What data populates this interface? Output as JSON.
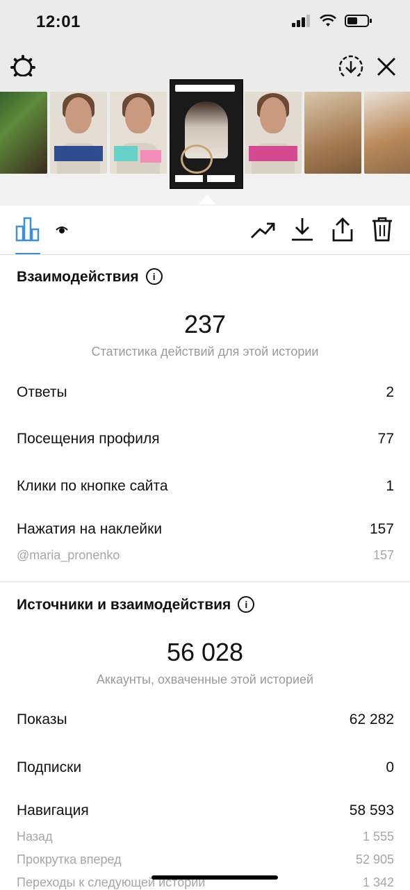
{
  "status_bar": {
    "time": "12:01"
  },
  "interactions": {
    "title": "Взаимодействия",
    "total": "237",
    "total_caption": "Статистика действий для этой истории",
    "rows": [
      {
        "label": "Ответы",
        "value": "2"
      },
      {
        "label": "Посещения профиля",
        "value": "77"
      },
      {
        "label": "Клики по кнопке сайта",
        "value": "1"
      },
      {
        "label": "Нажатия на наклейки",
        "value": "157"
      }
    ],
    "sticker_sub": {
      "label": "@maria_pronenko",
      "value": "157"
    }
  },
  "discovery": {
    "title": "Источники и взаимодействия",
    "total": "56 028",
    "total_caption": "Аккаунты, охваченные этой историей",
    "rows": [
      {
        "label": "Показы",
        "value": "62 282"
      },
      {
        "label": "Подписки",
        "value": "0"
      },
      {
        "label": "Навигация",
        "value": "58 593"
      }
    ],
    "navigation_sub": [
      {
        "label": "Назад",
        "value": "1 555"
      },
      {
        "label": "Прокрутка вперед",
        "value": "52 905"
      },
      {
        "label": "Переходы к следующей истории",
        "value": "1 342"
      }
    ]
  },
  "colors": {
    "accent": "#3b8fe0",
    "muted": "#9a9a9a"
  },
  "icons": [
    "settings-gear-icon",
    "download-circle-icon",
    "close-icon",
    "bar-chart-icon",
    "eye-icon",
    "trending-icon",
    "download-icon",
    "share-icon",
    "trash-icon"
  ]
}
